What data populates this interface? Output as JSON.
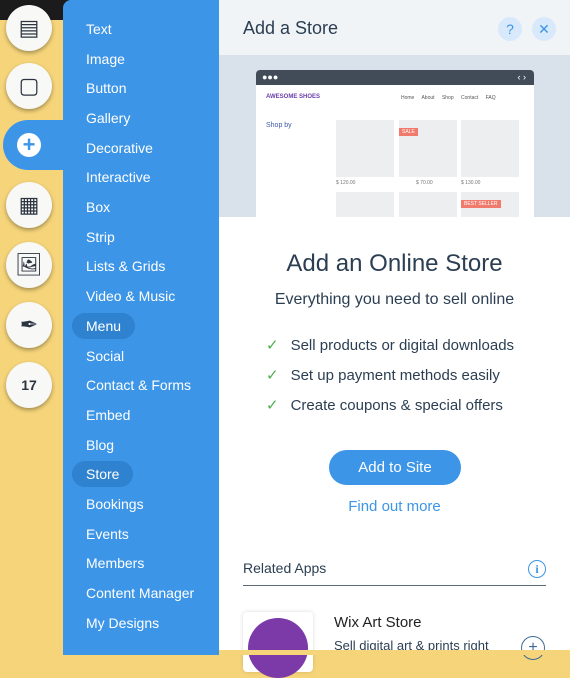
{
  "menu": {
    "items": [
      "Text",
      "Image",
      "Button",
      "Gallery",
      "Decorative",
      "Interactive",
      "Box",
      "Strip",
      "Lists & Grids",
      "Video & Music",
      "Menu",
      "Social",
      "Contact & Forms",
      "Embed",
      "Blog",
      "Store",
      "Bookings",
      "Events",
      "Members",
      "Content Manager",
      "My Designs"
    ],
    "highlighted": [
      "Menu",
      "Store"
    ]
  },
  "panel": {
    "title": "Add a Store",
    "help": "?",
    "close": "✕",
    "preview": {
      "brand": "AWESOME SHOES",
      "nav": [
        "Home",
        "About",
        "Shop",
        "Contact",
        "FAQ"
      ],
      "shop_by": "Shop by",
      "badges": [
        "SALE",
        "BEST SELLER"
      ],
      "prices": [
        "$ 120.00",
        "$ 70.00",
        "$ 130.00"
      ]
    },
    "heading": "Add an Online Store",
    "subheading": "Everything you need to sell online",
    "features": [
      "Sell products or digital downloads",
      "Set up payment methods easily",
      "Create coupons & special offers"
    ],
    "add_button": "Add to Site",
    "find_more": "Find out more",
    "related_title": "Related Apps",
    "info": "i",
    "app": {
      "name": "Wix Art Store",
      "desc": "Sell digital art & prints right",
      "add": "+"
    }
  },
  "colors": {
    "accent": "#3c95e6",
    "sidebar_bg": "#f6d57a"
  }
}
